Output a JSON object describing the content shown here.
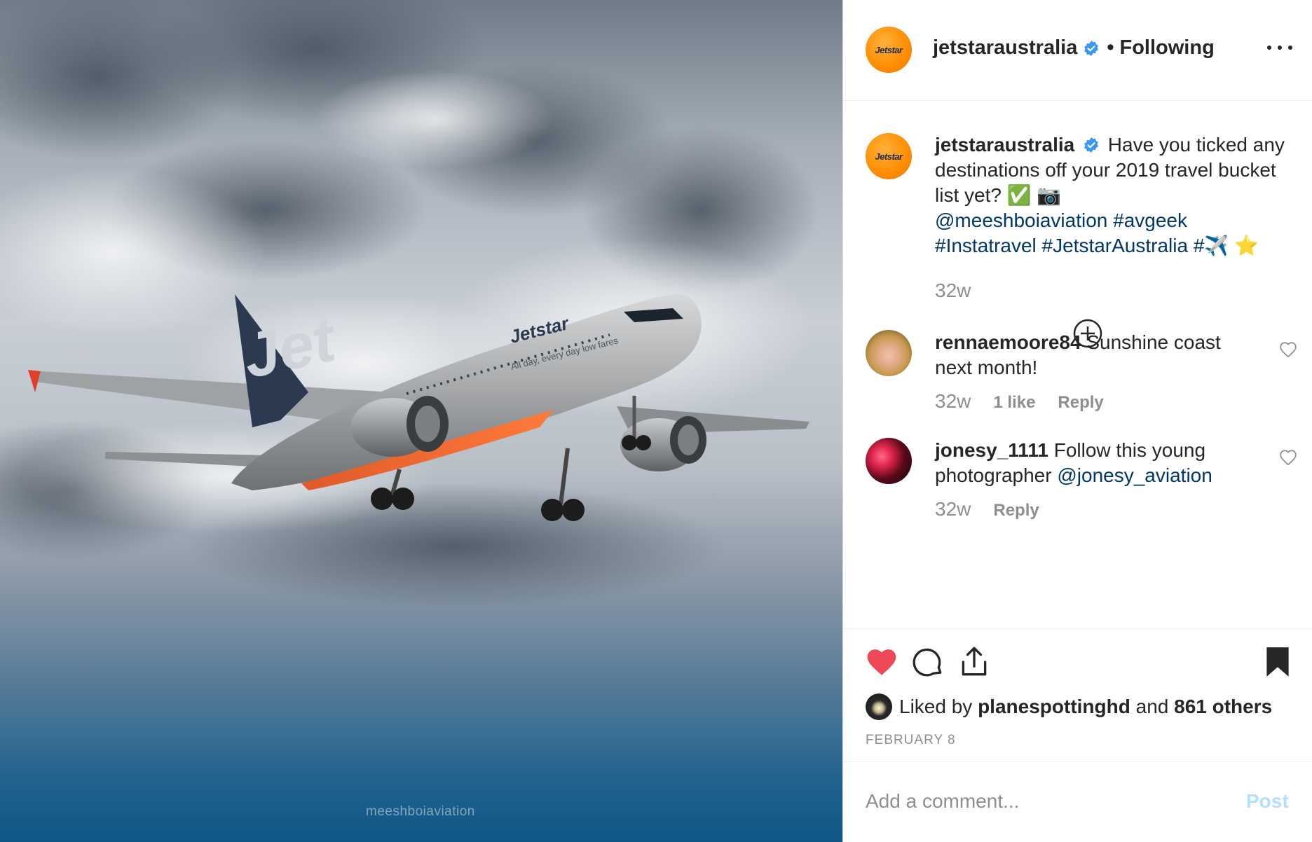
{
  "photo": {
    "watermark": "meeshboiaviation",
    "livery_text": "Jetstar",
    "livery_tagline": "All day, every day low fares"
  },
  "header": {
    "avatar_text": "Jetstar",
    "username": "jetstaraustralia",
    "verified_icon": "verified-badge-icon",
    "separator": "•",
    "follow_status": "Following",
    "more_icon": "more-options-icon"
  },
  "caption": {
    "username": "jetstaraustralia",
    "text": "Have you ticked any destinations off your 2019 travel bucket list yet?",
    "emoji": "✅ 📷",
    "mention": "@meeshboiaviation",
    "tags": [
      "#avgeek",
      "#Instatravel",
      "#JetstarAustralia",
      "#✈️"
    ],
    "trailing_emoji": "⭐",
    "time": "32w",
    "load_more_icon": "plus-circle-icon"
  },
  "comments": [
    {
      "username": "rennaemoore84",
      "text": "Sunshine coast next month!",
      "time": "32w",
      "likes": "1 like",
      "reply": "Reply"
    },
    {
      "username": "jonesy_1111",
      "text": "Follow this young photographer",
      "mention": "@jonesy_aviation",
      "time": "32w",
      "reply": "Reply"
    }
  ],
  "actions": {
    "like_icon": "heart-filled-icon",
    "comment_icon": "comment-icon",
    "share_icon": "share-icon",
    "save_icon": "bookmark-filled-icon",
    "liked_prefix": "Liked by",
    "liked_user": "planespottinghd",
    "liked_and": "and",
    "liked_others": "861 others",
    "date": "FEBRUARY 8"
  },
  "add_comment": {
    "placeholder": "Add a comment...",
    "post_label": "Post"
  },
  "colors": {
    "like_red": "#ed4956",
    "link_blue": "#00376b",
    "post_disabled": "#b2dffc",
    "jetstar_orange": "#ff8c00",
    "muted_gray": "#8e8e8e"
  }
}
